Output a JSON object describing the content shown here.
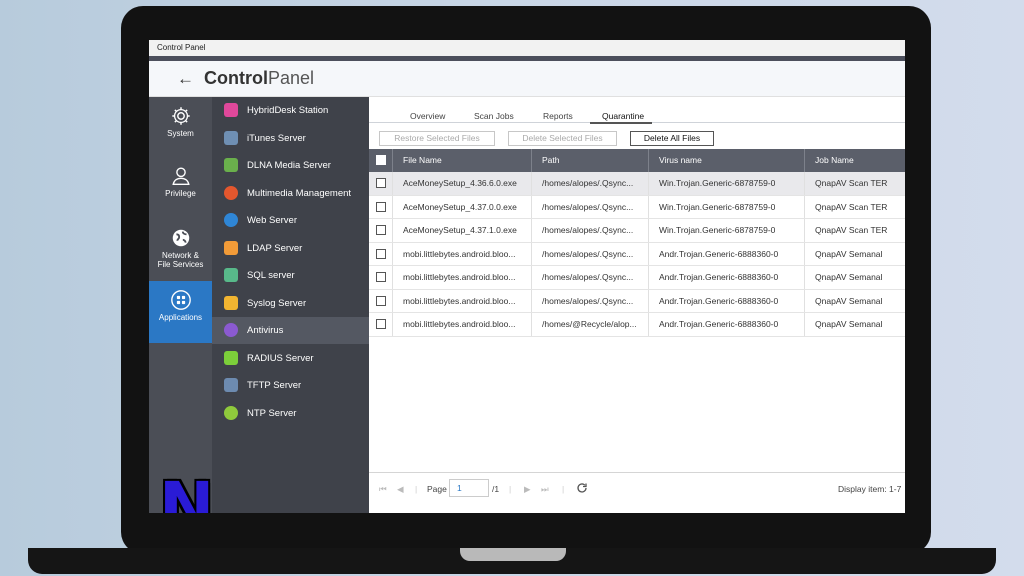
{
  "window": {
    "title": "Control Panel"
  },
  "header": {
    "title_bold": "Control",
    "title_light": "Panel"
  },
  "left_nav": [
    {
      "label": "System",
      "icon": "gear-icon"
    },
    {
      "label": "Privilege",
      "icon": "user-icon"
    },
    {
      "label": "Network &\nFile Services",
      "icon": "globe-icon"
    },
    {
      "label": "Applications",
      "icon": "apps-grid-icon",
      "active": true
    }
  ],
  "sub_nav": [
    {
      "label": "HybridDesk Station",
      "icon": "hybriddesk-icon",
      "color": "#e0489b"
    },
    {
      "label": "iTunes Server",
      "icon": "itunes-icon",
      "color": "#6f8fb3"
    },
    {
      "label": "DLNA Media Server",
      "icon": "dlna-icon",
      "color": "#6ab04c"
    },
    {
      "label": "Multimedia Management",
      "icon": "multimedia-icon",
      "color": "#e4572e"
    },
    {
      "label": "Web Server",
      "icon": "web-icon",
      "color": "#2f86d6"
    },
    {
      "label": "LDAP Server",
      "icon": "ldap-icon",
      "color": "#f29b38"
    },
    {
      "label": "SQL server",
      "icon": "sql-icon",
      "color": "#58b98a"
    },
    {
      "label": "Syslog Server",
      "icon": "syslog-icon",
      "color": "#f2b531"
    },
    {
      "label": "Antivirus",
      "icon": "antivirus-icon",
      "color": "#8b5ad1",
      "active": true
    },
    {
      "label": "RADIUS Server",
      "icon": "radius-icon",
      "color": "#7ccf3a"
    },
    {
      "label": "TFTP Server",
      "icon": "tftp-icon",
      "color": "#6d8bb0"
    },
    {
      "label": "NTP Server",
      "icon": "ntp-icon",
      "color": "#8fca3c"
    }
  ],
  "tabs": [
    "Overview",
    "Scan Jobs",
    "Reports",
    "Quarantine"
  ],
  "active_tab": "Quarantine",
  "toolbar": {
    "restore": "Restore Selected Files",
    "delete_selected": "Delete Selected Files",
    "delete_all": "Delete All Files"
  },
  "table": {
    "columns": [
      "File Name",
      "Path",
      "Virus name",
      "Job Name"
    ],
    "rows": [
      [
        "AceMoneySetup_4.36.6.0.exe",
        "/homes/alopes/.Qsync...",
        "Win.Trojan.Generic-6878759-0",
        "QnapAV Scan TER"
      ],
      [
        "AceMoneySetup_4.37.0.0.exe",
        "/homes/alopes/.Qsync...",
        "Win.Trojan.Generic-6878759-0",
        "QnapAV Scan TER"
      ],
      [
        "AceMoneySetup_4.37.1.0.exe",
        "/homes/alopes/.Qsync...",
        "Win.Trojan.Generic-6878759-0",
        "QnapAV Scan TER"
      ],
      [
        "mobi.littlebytes.android.bloo...",
        "/homes/alopes/.Qsync...",
        "Andr.Trojan.Generic-6888360-0",
        "QnapAV Semanal"
      ],
      [
        "mobi.littlebytes.android.bloo...",
        "/homes/alopes/.Qsync...",
        "Andr.Trojan.Generic-6888360-0",
        "QnapAV Semanal"
      ],
      [
        "mobi.littlebytes.android.bloo...",
        "/homes/alopes/.Qsync...",
        "Andr.Trojan.Generic-6888360-0",
        "QnapAV Semanal"
      ],
      [
        "mobi.littlebytes.android.bloo...",
        "/homes/@Recycle/alop...",
        "Andr.Trojan.Generic-6888360-0",
        "QnapAV Semanal"
      ]
    ]
  },
  "pager": {
    "page_label": "Page",
    "page_value": "1",
    "total": "/1",
    "display": "Display item: 1-7"
  },
  "colors": {
    "accent": "#2b78c5",
    "nav_bg": "#4b4e56",
    "header_bg": "#5b5f6a"
  }
}
